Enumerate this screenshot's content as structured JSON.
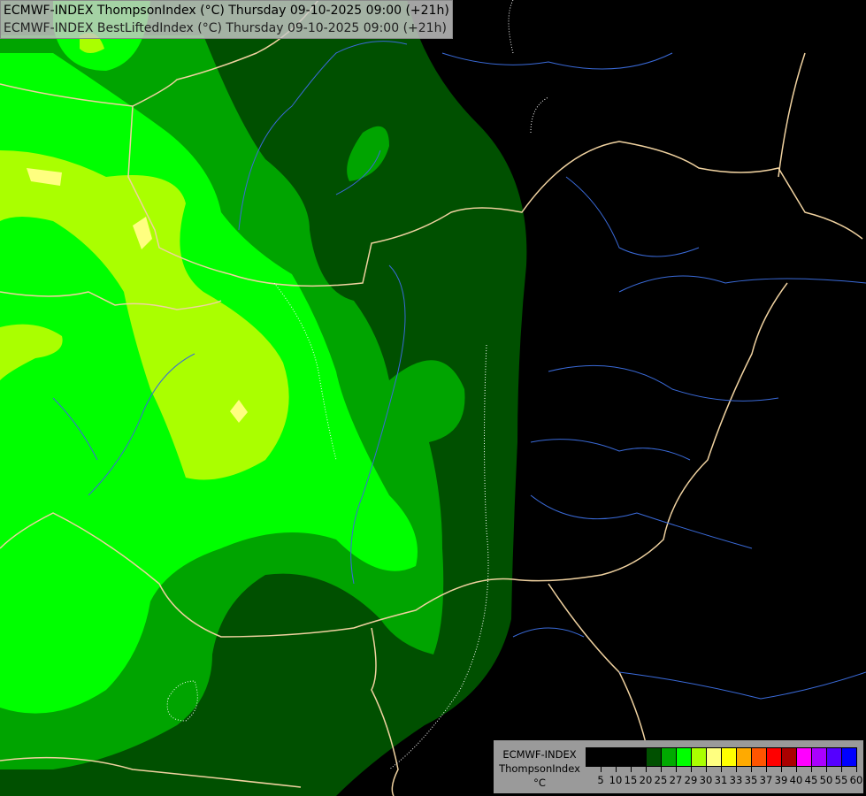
{
  "title": {
    "line1": "ECMWF-INDEX ThompsonIndex (°C) Thursday 09-10-2025 09:00 (+21h)",
    "line2": "ECMWF-INDEX BestLiftedIndex (°C) Thursday 09-10-2025 09:00 (+21h)"
  },
  "legend": {
    "source": "ECMWF-INDEX",
    "parameter": "ThompsonIndex",
    "unit": "°C",
    "colors": [
      "#000000",
      "#000000",
      "#000000",
      "#000000",
      "#005000",
      "#00aa00",
      "#00ff00",
      "#aaff00",
      "#ffff80",
      "#ffff00",
      "#ffaa00",
      "#ff5500",
      "#ff0000",
      "#aa0000",
      "#ff00ff",
      "#aa00ff",
      "#5500ff",
      "#0000ff"
    ],
    "labels": [
      "5",
      "10",
      "15",
      "20",
      "25",
      "27",
      "29",
      "30",
      "31",
      "33",
      "35",
      "37",
      "39",
      "40",
      "45",
      "50",
      "55",
      "60"
    ]
  },
  "map_colors": {
    "border": "#f0d2a0",
    "river": "#3a6ad8",
    "contour": "#ffffff"
  }
}
